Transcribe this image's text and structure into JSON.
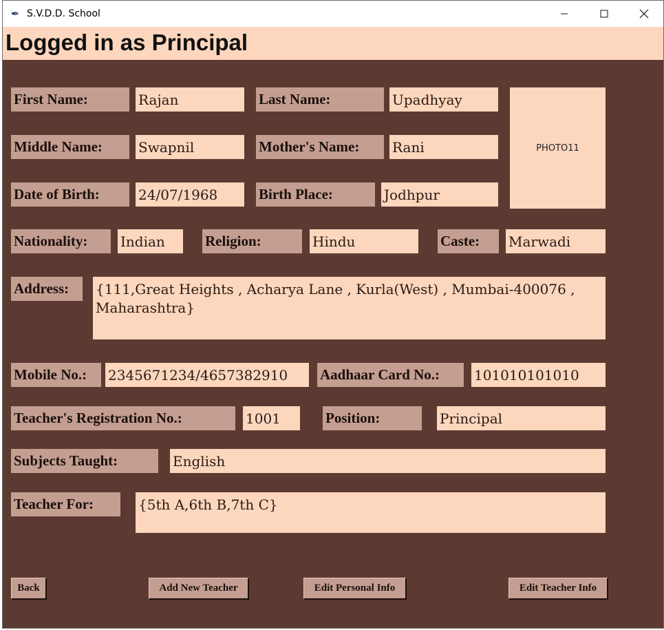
{
  "window": {
    "title": "S.V.D.D. School",
    "icon": "feather-icon",
    "controls": {
      "minimize": "—",
      "maximize": "☐",
      "close": "✕"
    }
  },
  "header": {
    "title": "Logged in as Principal"
  },
  "form": {
    "first_name": {
      "label": "First Name:",
      "value": "Rajan"
    },
    "last_name": {
      "label": "Last Name:",
      "value": "Upadhyay"
    },
    "middle_name": {
      "label": "Middle Name:",
      "value": "Swapnil"
    },
    "mothers_name": {
      "label": "Mother's Name:",
      "value": "Rani"
    },
    "dob": {
      "label": "Date of Birth:",
      "value": "24/07/1968"
    },
    "birth_place": {
      "label": "Birth Place:",
      "value": "Jodhpur"
    },
    "nationality": {
      "label": "Nationality:",
      "value": "Indian"
    },
    "religion": {
      "label": "Religion:",
      "value": "Hindu"
    },
    "caste": {
      "label": "Caste:",
      "value": "Marwadi"
    },
    "address": {
      "label": "Address:",
      "value": "{111,Great Heights , Acharya Lane , Kurla(West) , Mumbai-400076 , Maharashtra}"
    },
    "mobile": {
      "label": "Mobile No.:",
      "value": "2345671234/4657382910"
    },
    "aadhaar": {
      "label": "Aadhaar Card No.:",
      "value": "101010101010"
    },
    "registration": {
      "label": "Teacher's Registration No.:",
      "value": "1001"
    },
    "position": {
      "label": "Position:",
      "value": "Principal"
    },
    "subjects": {
      "label": "Subjects Taught:",
      "value": "English"
    },
    "teacher_for": {
      "label": "Teacher For:",
      "value": "{5th A,6th B,7th C}"
    },
    "photo": "PHOTO11"
  },
  "buttons": {
    "back": "Back",
    "add_teacher": "Add New Teacher",
    "edit_personal": "Edit Personal Info",
    "edit_teacher": "Edit Teacher Info"
  },
  "colors": {
    "background": "#5c3a31",
    "label_bg": "#c49e91",
    "value_bg": "#fcd6bd"
  }
}
